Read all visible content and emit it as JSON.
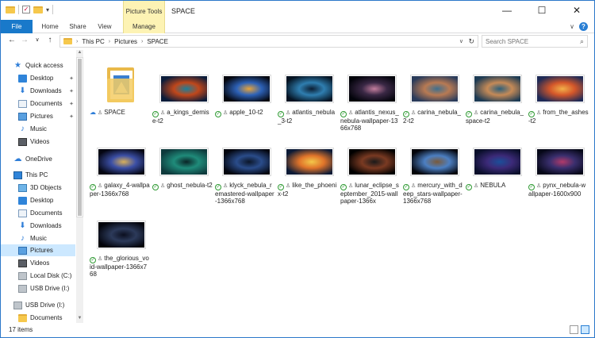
{
  "window": {
    "title": "SPACE",
    "contextual_tab": "Picture Tools",
    "controls": [
      "—",
      "☐",
      "✕"
    ]
  },
  "ribbon": {
    "tabs": [
      "File",
      "Home",
      "Share",
      "View",
      "Manage"
    ]
  },
  "address": {
    "crumbs": [
      "This PC",
      "Pictures",
      "SPACE"
    ],
    "search_placeholder": "Search SPACE"
  },
  "nav": {
    "items": [
      {
        "label": "Quick access",
        "icon": "star-icon"
      },
      {
        "label": "Desktop",
        "icon": "desktop-icon",
        "pinned": true
      },
      {
        "label": "Downloads",
        "icon": "downloads-icon",
        "pinned": true
      },
      {
        "label": "Documents",
        "icon": "documents-icon",
        "pinned": true
      },
      {
        "label": "Pictures",
        "icon": "pictures-icon",
        "pinned": true
      },
      {
        "label": "Music",
        "icon": "music-icon"
      },
      {
        "label": "Videos",
        "icon": "videos-icon"
      },
      {
        "label": "OneDrive",
        "icon": "onedrive-icon"
      },
      {
        "label": "This PC",
        "icon": "this-pc-icon"
      },
      {
        "label": "3D Objects",
        "icon": "3d-objects-icon"
      },
      {
        "label": "Desktop",
        "icon": "desktop-icon"
      },
      {
        "label": "Documents",
        "icon": "documents-icon"
      },
      {
        "label": "Downloads",
        "icon": "downloads-icon"
      },
      {
        "label": "Music",
        "icon": "music-icon"
      },
      {
        "label": "Pictures",
        "icon": "pictures-icon",
        "selected": true
      },
      {
        "label": "Videos",
        "icon": "videos-icon"
      },
      {
        "label": "Local Disk (C:)",
        "icon": "local-disk-icon"
      },
      {
        "label": "USB Drive (I:)",
        "icon": "usb-drive-icon"
      },
      {
        "label": "USB Drive (I:)",
        "icon": "usb-drive-icon"
      },
      {
        "label": "Documents",
        "icon": "documents-icon"
      }
    ]
  },
  "files": [
    {
      "name": "SPACE",
      "type": "folder",
      "status": "cloud"
    },
    {
      "name": "a_kings_demise-t2",
      "colors": [
        "#0b1c3a",
        "#c0471b",
        "#1c7f9a"
      ]
    },
    {
      "name": "apple_10-t2",
      "colors": [
        "#05070f",
        "#2d62b8",
        "#e8a43a"
      ]
    },
    {
      "name": "atlantis_nebula_3-t2",
      "colors": [
        "#051322",
        "#2f7eb0",
        "#0b1e33"
      ]
    },
    {
      "name": "atlantis_nexus_nebula-wallpaper-1366x768",
      "colors": [
        "#02030a",
        "#3a2845",
        "#c47e9e"
      ]
    },
    {
      "name": "carina_nebula_2-t2",
      "colors": [
        "#2a3b5a",
        "#b87a53",
        "#3f6f8e"
      ]
    },
    {
      "name": "carina_nebula_space-t2",
      "colors": [
        "#1d3b54",
        "#c58a57",
        "#2c5f7a"
      ]
    },
    {
      "name": "from_the_ashes-t2",
      "colors": [
        "#1f2a56",
        "#d4572a",
        "#f2b04a"
      ]
    },
    {
      "name": "galaxy_4-wallpaper-1366x768",
      "colors": [
        "#050612",
        "#3b4fa6",
        "#d9b05a"
      ]
    },
    {
      "name": "ghost_nebula-t2",
      "colors": [
        "#0e3a3c",
        "#1f8b7a",
        "#0a2426"
      ]
    },
    {
      "name": "klyck_nebula_remastered-wallpaper-1366x768",
      "colors": [
        "#04060f",
        "#2a4c8a",
        "#0b1629"
      ]
    },
    {
      "name": "like_the_phoenix-t2",
      "colors": [
        "#0b1a36",
        "#e0742a",
        "#f3c84a"
      ]
    },
    {
      "name": "lunar_eclipse_september_2015-wallpaper-1366x",
      "colors": [
        "#000000",
        "#7a3a22",
        "#1a1a1a"
      ]
    },
    {
      "name": "mercury_with_deep_stars-wallpaper-1366x768",
      "colors": [
        "#03040a",
        "#4c7fc2",
        "#7a5a3a"
      ]
    },
    {
      "name": "NEBULA",
      "colors": [
        "#0a0f2a",
        "#3c2a78",
        "#1b4f9a"
      ]
    },
    {
      "name": "pynx_nebula-wallpaper-1600x900",
      "colors": [
        "#060818",
        "#3a2f6e",
        "#b23a6a"
      ]
    },
    {
      "name": "the_glorious_void-wallpaper-1366x768",
      "colors": [
        "#02030a",
        "#2c3a5a",
        "#0b0f1f"
      ]
    }
  ],
  "status": {
    "count": "17 items"
  }
}
